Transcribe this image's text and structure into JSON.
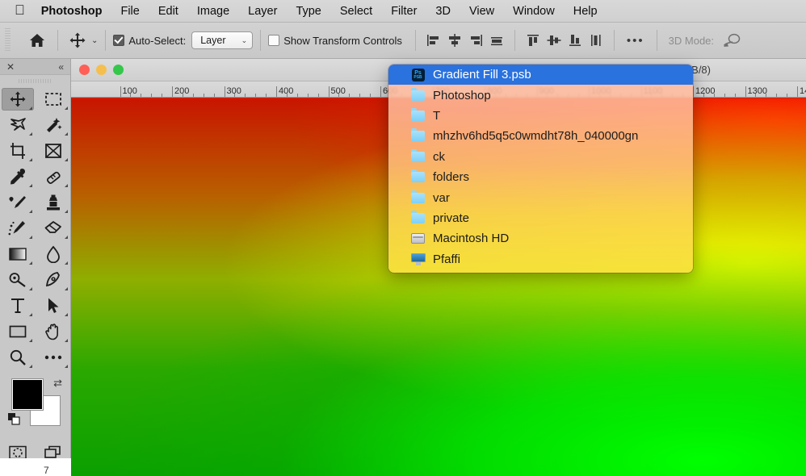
{
  "menubar": {
    "apple_icon": "apple-icon",
    "items": [
      {
        "label": "Photoshop",
        "bold": true
      },
      {
        "label": "File"
      },
      {
        "label": "Edit"
      },
      {
        "label": "Image"
      },
      {
        "label": "Layer"
      },
      {
        "label": "Type"
      },
      {
        "label": "Select"
      },
      {
        "label": "Filter"
      },
      {
        "label": "3D"
      },
      {
        "label": "View"
      },
      {
        "label": "Window"
      },
      {
        "label": "Help"
      }
    ]
  },
  "options_bar": {
    "home_icon": "home-icon",
    "tool_icon": "move-tool-icon",
    "tool_chevron": "⌄",
    "auto_select_label": "Auto-Select:",
    "auto_select_checked": true,
    "layer_select_value": "Layer",
    "layer_select_chevron": "⌄",
    "show_transform_label": "Show Transform Controls",
    "show_transform_checked": false,
    "align_icons": [
      "align-left-edges-icon",
      "align-horizontal-centers-icon",
      "align-right-edges-icon",
      "distribute-horizontal-icon"
    ],
    "align_icons2": [
      "align-top-edges-icon",
      "align-vertical-centers-icon",
      "align-bottom-edges-icon",
      "distribute-vertical-icon"
    ],
    "overflow_label": "•••",
    "mode_3d_label": "3D Mode:",
    "mode_3d_icon": "rotate-3d-icon"
  },
  "tools_panel": {
    "close_icon": "✕",
    "collapse_icon": "«",
    "tools": [
      {
        "name": "move-tool",
        "selected": true
      },
      {
        "name": "rectangular-marquee-tool",
        "selected": false
      },
      {
        "name": "lasso-tool",
        "selected": false
      },
      {
        "name": "magic-wand-tool",
        "selected": false
      },
      {
        "name": "crop-tool",
        "selected": false
      },
      {
        "name": "frame-tool",
        "selected": false
      },
      {
        "name": "eyedropper-tool",
        "selected": false
      },
      {
        "name": "healing-brush-tool",
        "selected": false
      },
      {
        "name": "brush-tool",
        "selected": false
      },
      {
        "name": "clone-stamp-tool",
        "selected": false
      },
      {
        "name": "history-brush-tool",
        "selected": false
      },
      {
        "name": "eraser-tool",
        "selected": false
      },
      {
        "name": "gradient-tool",
        "selected": false
      },
      {
        "name": "blur-tool",
        "selected": false
      },
      {
        "name": "dodge-tool",
        "selected": false
      },
      {
        "name": "pen-tool",
        "selected": false
      },
      {
        "name": "type-tool",
        "selected": false
      },
      {
        "name": "path-selection-tool",
        "selected": false
      },
      {
        "name": "rectangle-tool",
        "selected": false
      },
      {
        "name": "hand-tool",
        "selected": false
      },
      {
        "name": "zoom-tool",
        "selected": false
      },
      {
        "name": "edit-toolbar-tool",
        "selected": false
      }
    ],
    "foreground_color": "#000000",
    "background_color": "#ffffff",
    "swap_icon": "⇄",
    "quick_mask_name": "quick-mask-button",
    "screen_mode_name": "screen-mode-button"
  },
  "document_window": {
    "traffic_lights": [
      "close",
      "minimize",
      "zoom"
    ],
    "title": ", RGB/8)",
    "ruler_marks": [
      "100",
      "200",
      "300",
      "400",
      "500",
      "600",
      "700",
      "800",
      "900",
      "1000",
      "1100",
      "1200",
      "1300",
      "1400"
    ]
  },
  "popup_menu": {
    "items": [
      {
        "label": "Gradient Fill 3.psb",
        "icon": "psb-file-icon",
        "selected": true
      },
      {
        "label": "Photoshop",
        "icon": "folder-icon",
        "selected": false
      },
      {
        "label": "T",
        "icon": "folder-icon",
        "selected": false
      },
      {
        "label": "mhzhv6hd5q5c0wmdht78h_040000gn",
        "icon": "folder-icon",
        "selected": false
      },
      {
        "label": "ck",
        "icon": "folder-icon",
        "selected": false
      },
      {
        "label": "folders",
        "icon": "folder-icon",
        "selected": false
      },
      {
        "label": "var",
        "icon": "folder-icon",
        "selected": false
      },
      {
        "label": "private",
        "icon": "folder-icon",
        "selected": false
      },
      {
        "label": "Macintosh HD",
        "icon": "hard-drive-icon",
        "selected": false
      },
      {
        "label": "Pfaffi",
        "icon": "computer-icon",
        "selected": false
      }
    ],
    "selection_color": "#2a72de"
  },
  "status_bar": {
    "zoom_fragment": "7"
  }
}
